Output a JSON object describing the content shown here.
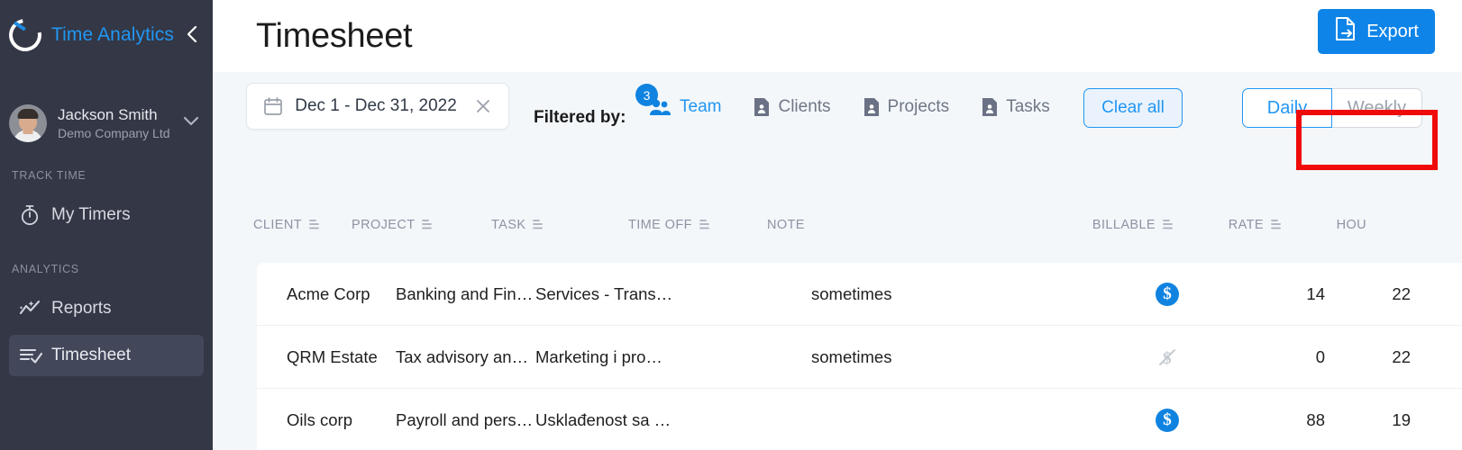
{
  "brand": {
    "name": "Time Analytics",
    "logo_icon": "time-analytics-logo",
    "collapse_icon": "chevron-left-icon"
  },
  "user": {
    "name": "Jackson Smith",
    "company": "Demo Company Ltd",
    "avatar_icon": "user-avatar",
    "caret_icon": "chevron-down-icon"
  },
  "sidebar": {
    "sections": [
      {
        "label": "TRACK TIME",
        "items": [
          {
            "label": "My Timers",
            "icon": "stopwatch-icon",
            "active": false
          }
        ]
      },
      {
        "label": "ANALYTICS",
        "items": [
          {
            "label": "Reports",
            "icon": "analytics-line-icon",
            "active": false
          },
          {
            "label": "Timesheet",
            "icon": "timesheet-check-icon",
            "active": true
          }
        ]
      }
    ]
  },
  "header": {
    "title": "Timesheet",
    "export_label": "Export",
    "export_icon": "export-file-icon",
    "export_color": "#0f84e8"
  },
  "filterbar": {
    "date_range": "Dec 1 - Dec 31, 2022",
    "date_icon": "calendar-icon",
    "date_clear_icon": "close-icon",
    "filtered_by_label": "Filtered by:",
    "filters": [
      {
        "label": "Team",
        "icon": "team-people-icon",
        "badge": "3",
        "active": true
      },
      {
        "label": "Clients",
        "icon": "client-file-icon",
        "badge": "",
        "active": false
      },
      {
        "label": "Projects",
        "icon": "project-file-icon",
        "badge": "",
        "active": false
      },
      {
        "label": "Tasks",
        "icon": "task-file-icon",
        "badge": "",
        "active": false
      }
    ],
    "clear_all_label": "Clear all",
    "view_toggle": {
      "daily_label": "Daily",
      "weekly_label": "Weekly",
      "selected": "Daily"
    },
    "highlight_color": "#f00b0b"
  },
  "table": {
    "columns": [
      {
        "key": "client",
        "label": "CLIENT",
        "sortable": true
      },
      {
        "key": "project",
        "label": "PROJECT",
        "sortable": true
      },
      {
        "key": "task",
        "label": "TASK",
        "sortable": true
      },
      {
        "key": "timeoff",
        "label": "TIME OFF",
        "sortable": true
      },
      {
        "key": "note",
        "label": "NOTE",
        "sortable": false
      },
      {
        "key": "billable",
        "label": "BILLABLE",
        "sortable": true
      },
      {
        "key": "rate",
        "label": "RATE",
        "sortable": true
      },
      {
        "key": "hours",
        "label": "HOU",
        "sortable": false
      }
    ],
    "rows": [
      {
        "client": "Acme Corp",
        "project": "Banking and Fin…",
        "task": "Services - Trans…",
        "timeoff": "",
        "note": "sometimes",
        "billable": true,
        "rate": "14",
        "hours": "22"
      },
      {
        "client": "QRM Estate",
        "project": "Tax advisory an…",
        "task": "Marketing i pro…",
        "timeoff": "",
        "note": "sometimes",
        "billable": false,
        "rate": "0",
        "hours": "22"
      },
      {
        "client": "Oils corp",
        "project": "Payroll and pers…",
        "task": "Usklađenost sa …",
        "timeoff": "",
        "note": "",
        "billable": true,
        "rate": "88",
        "hours": "19"
      }
    ]
  }
}
